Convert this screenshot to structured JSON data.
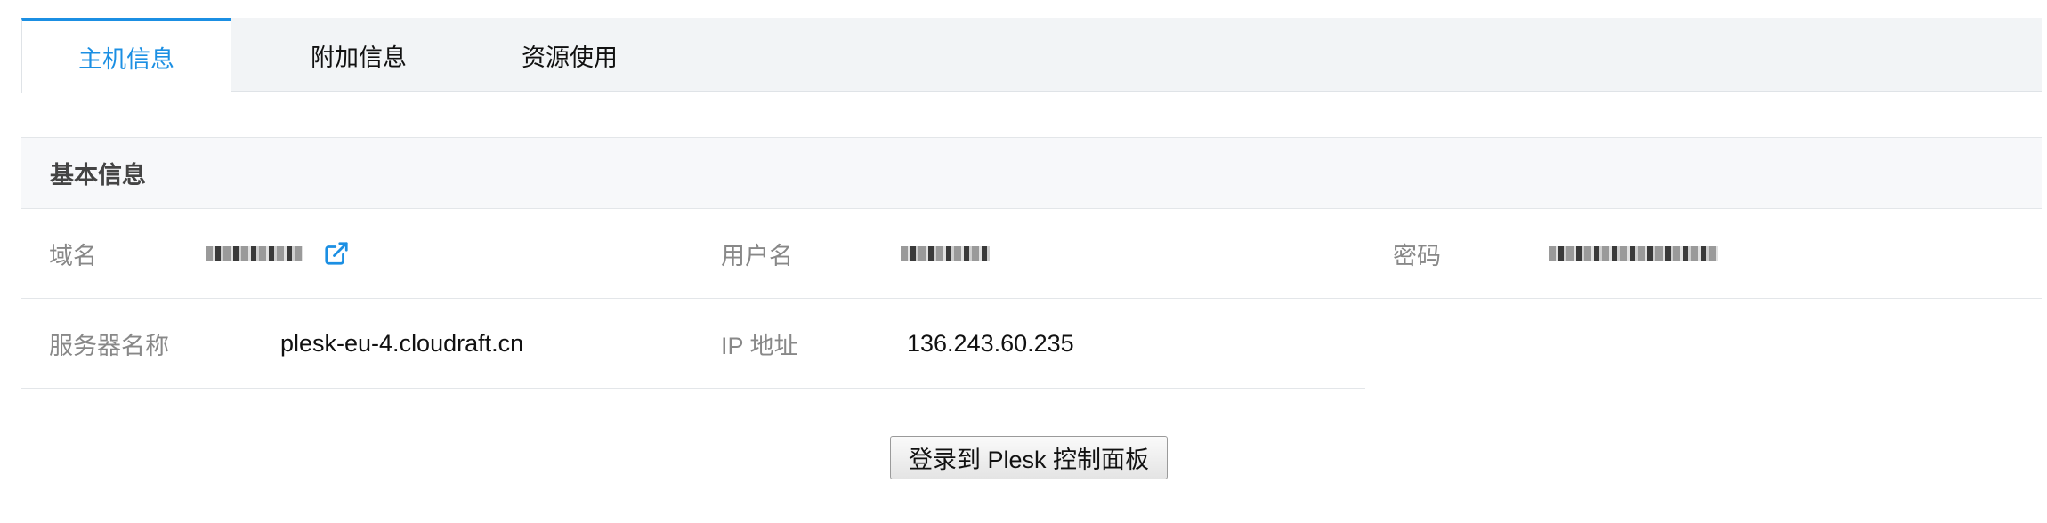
{
  "tabs": [
    {
      "label": "主机信息",
      "active": true
    },
    {
      "label": "附加信息",
      "active": false
    },
    {
      "label": "资源使用",
      "active": false
    }
  ],
  "section": {
    "title": "基本信息"
  },
  "fields": {
    "domain": {
      "label": "域名",
      "value": "",
      "redacted": true
    },
    "username": {
      "label": "用户名",
      "value": "",
      "redacted": true
    },
    "password": {
      "label": "密码",
      "value": "",
      "redacted": true
    },
    "server_name": {
      "label": "服务器名称",
      "value": "plesk-eu-4.cloudraft.cn"
    },
    "ip": {
      "label": "IP 地址",
      "value": "136.243.60.235"
    }
  },
  "login_button": {
    "label": "登录到 Plesk 控制面板"
  },
  "colors": {
    "accent": "#1b8fe3",
    "label": "#888888",
    "text": "#111111"
  },
  "icons": {
    "domain_link": "external-link-icon"
  }
}
